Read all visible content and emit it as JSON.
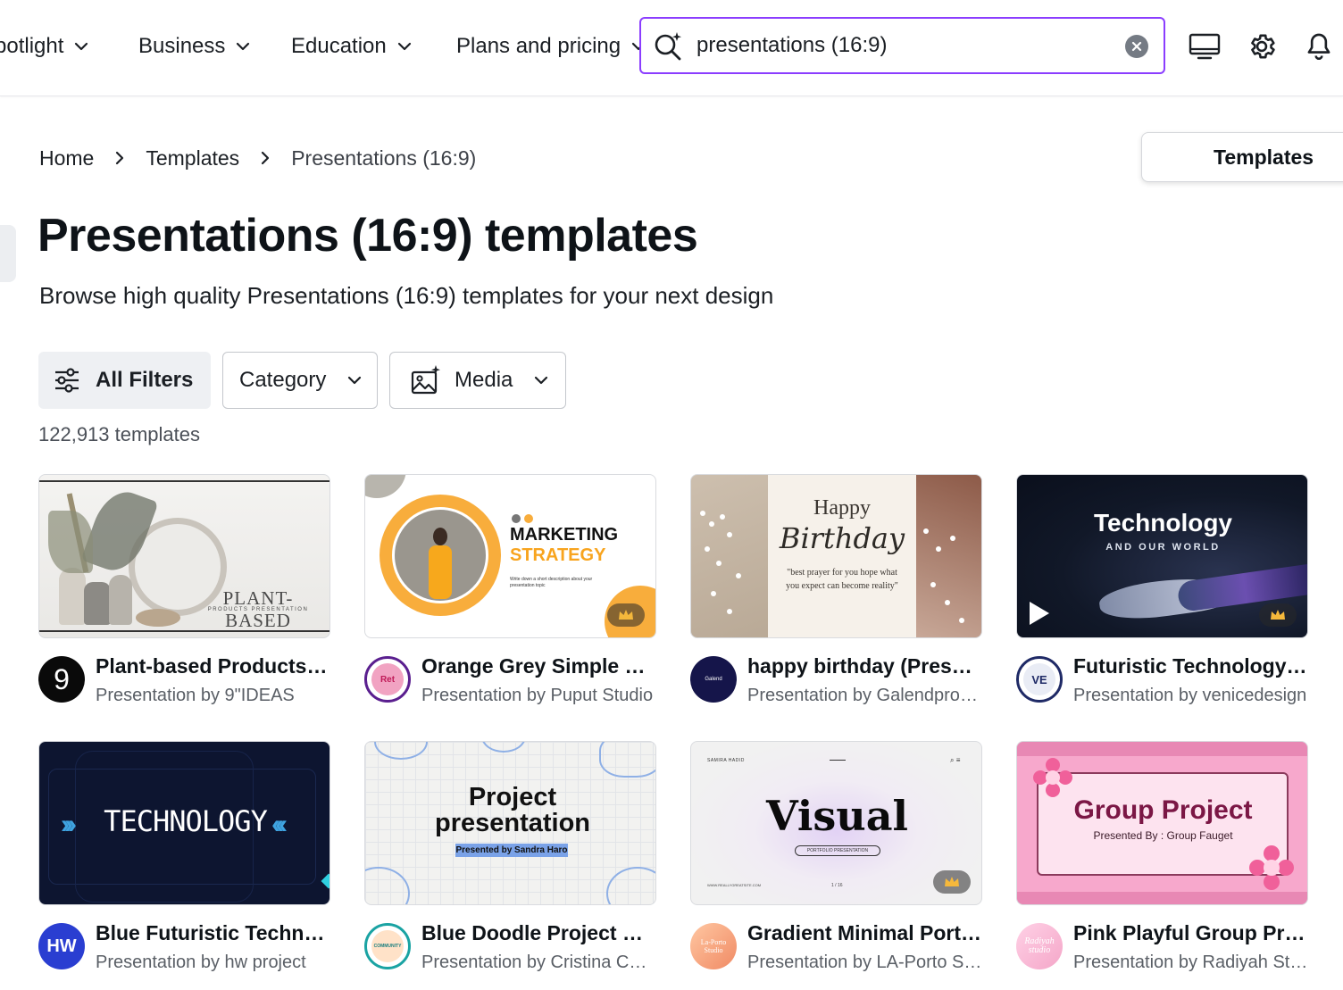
{
  "nav": {
    "items": [
      {
        "label": "Spotlight"
      },
      {
        "label": "Business"
      },
      {
        "label": "Education"
      },
      {
        "label": "Plans and pricing"
      }
    ],
    "search_value": "presentations (16:9)"
  },
  "breadcrumb": {
    "home": "Home",
    "templates": "Templates",
    "current": "Presentations (16:9)"
  },
  "side_tab": {
    "label": "Templates"
  },
  "page": {
    "title": "Presentations (16:9) templates",
    "subtitle": "Browse high quality Presentations (16:9) templates for your next design",
    "count": "122,913 templates"
  },
  "filters": {
    "all": "All Filters",
    "category": "Category",
    "media": "Media"
  },
  "cards": [
    {
      "title": "Plant-based Products Presentation",
      "author": "Presentation by 9\"IDEAS",
      "thumb_text": "PLANT-BASED",
      "thumb_sub": "PRODUCTS PRESENTATION",
      "avatar_text": "9",
      "premium": false
    },
    {
      "title": "Orange Grey Simple Elegant Marketing Strategy",
      "author": "Presentation by Puput Studio",
      "thumb_text": "MARKETING",
      "thumb_sub": "STRATEGY",
      "thumb_note": "Write down a short description about your presentation topic",
      "avatar_text": "Ret",
      "premium": true
    },
    {
      "title": "happy birthday (Presentation)",
      "author": "Presentation by Galendpro Studio",
      "thumb_text": "Happy",
      "thumb_sub": "Birthday",
      "thumb_note": "\"best prayer for you hope what you expect can become reality\"",
      "avatar_text": "Galend",
      "premium": false
    },
    {
      "title": "Futuristic Technology Presentation",
      "author": "Presentation by venicedesign",
      "thumb_text": "Technology",
      "thumb_sub": "AND OUR WORLD",
      "avatar_text": "VE",
      "premium": true
    },
    {
      "title": "Blue Futuristic Technology Presentation",
      "author": "Presentation by hw project",
      "thumb_text": "TECHNOLOGY",
      "avatar_text": "HW",
      "premium": false
    },
    {
      "title": "Blue Doodle Project Presentation",
      "author": "Presentation by Cristina Cañas",
      "thumb_text": "Project presentation",
      "thumb_sub": "Presented by Sandra Haro",
      "avatar_text": "COMMUNITY",
      "premium": false
    },
    {
      "title": "Gradient Minimal Portfolio Presentation",
      "author": "Presentation by LA-Porto Studio",
      "thumb_text": "Visual",
      "thumb_sub": "PORTFOLIO PRESENTATION",
      "thumb_note": "SAMIRA HADID",
      "thumb_note2": "WWW.REALLYGREATSITE.COM",
      "thumb_page": "1 / 16",
      "avatar_text": "La-Porto Studio",
      "premium": true
    },
    {
      "title": "Pink Playful Group Project Presentation",
      "author": "Presentation by Radiyah Studio",
      "thumb_text": "Group Project",
      "thumb_sub": "Presented By : Group Fauget",
      "avatar_text": "Radiyah studio",
      "premium": false
    }
  ],
  "colors": {
    "accent": "#8b3dff",
    "text": "#0e1318",
    "muted": "#5a5f66"
  }
}
